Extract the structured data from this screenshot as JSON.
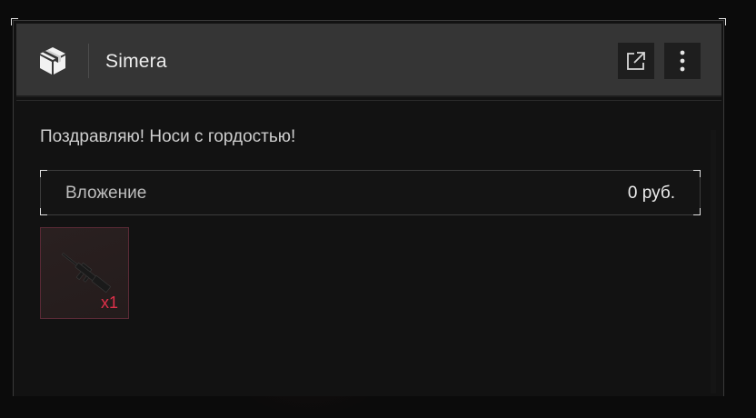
{
  "header": {
    "icon": "package-box-icon",
    "title": "Simera",
    "actions": [
      {
        "icon": "external-link-icon"
      },
      {
        "icon": "more-vertical-icon"
      }
    ]
  },
  "message": "Поздравляю! Носи с гордостью!",
  "investment": {
    "label": "Вложение",
    "value": "0 руб."
  },
  "items": [
    {
      "icon": "rifle-icon",
      "quantity": "x1"
    }
  ],
  "colors": {
    "panel_bg": "#121212",
    "header_bg": "#353535",
    "accent_red": "#e0304a",
    "item_border": "#5a2a36"
  }
}
